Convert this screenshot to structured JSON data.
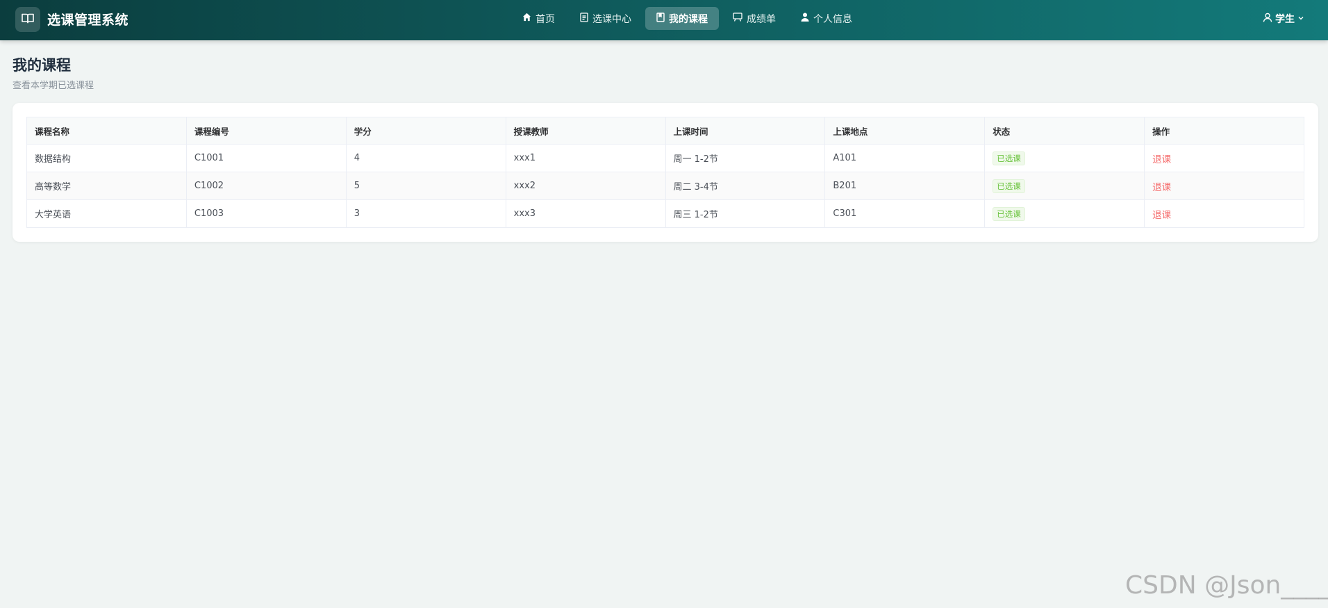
{
  "header": {
    "app_title": "选课管理系统",
    "logo_icon": "book-open-icon",
    "nav": [
      {
        "label": "首页",
        "icon": "home-icon",
        "active": false
      },
      {
        "label": "选课中心",
        "icon": "document-icon",
        "active": false
      },
      {
        "label": "我的课程",
        "icon": "bookmark-book-icon",
        "active": true
      },
      {
        "label": "成绩单",
        "icon": "presentation-board-icon",
        "active": false
      },
      {
        "label": "个人信息",
        "icon": "person-icon",
        "active": false
      }
    ],
    "user": {
      "label": "学生",
      "icon": "user-outline-icon",
      "dropdown_icon": "chevron-down-icon"
    }
  },
  "page": {
    "title": "我的课程",
    "subtitle": "查看本学期已选课程"
  },
  "table": {
    "columns": [
      "课程名称",
      "课程编号",
      "学分",
      "授课教师",
      "上课时间",
      "上课地点",
      "状态",
      "操作"
    ],
    "rows": [
      {
        "name": "数据结构",
        "code": "C1001",
        "credits": "4",
        "teacher": "xxx1",
        "time": "周一 1-2节",
        "location": "A101",
        "status": "已选课",
        "action": "退课"
      },
      {
        "name": "高等数学",
        "code": "C1002",
        "credits": "5",
        "teacher": "xxx2",
        "time": "周二 3-4节",
        "location": "B201",
        "status": "已选课",
        "action": "退课"
      },
      {
        "name": "大学英语",
        "code": "C1003",
        "credits": "3",
        "teacher": "xxx3",
        "time": "周三 1-2节",
        "location": "C301",
        "status": "已选课",
        "action": "退课"
      }
    ]
  },
  "watermark": "CSDN @Json_____",
  "colors": {
    "header_start": "#0b3d3e",
    "header_end": "#137a7a",
    "status_green": "#67c23a",
    "danger_red": "#f56c6c",
    "background": "#f0f4f3"
  }
}
